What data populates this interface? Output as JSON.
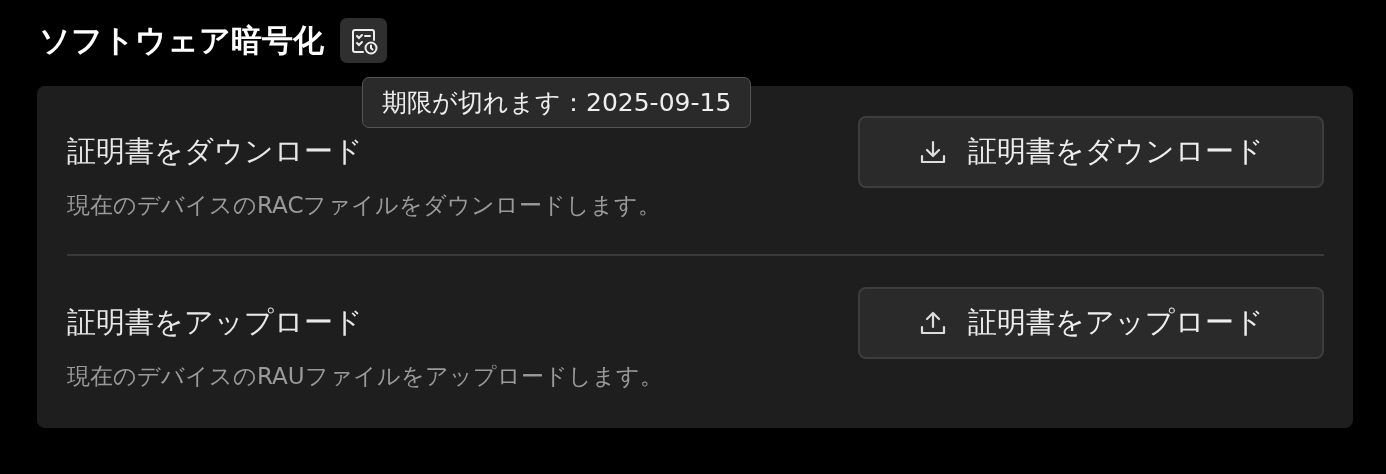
{
  "section": {
    "title": "ソフトウェア暗号化",
    "tooltip": "期限が切れます：2025-09-15"
  },
  "rows": [
    {
      "kind": "download",
      "title": "証明書をダウンロード",
      "description": "現在のデバイスのRACファイルをダウンロードします。",
      "button": "証明書をダウンロード"
    },
    {
      "kind": "upload",
      "title": "証明書をアップロード",
      "description": "現在のデバイスのRAUファイルをアップロードします。",
      "button": "証明書をアップロード"
    }
  ]
}
